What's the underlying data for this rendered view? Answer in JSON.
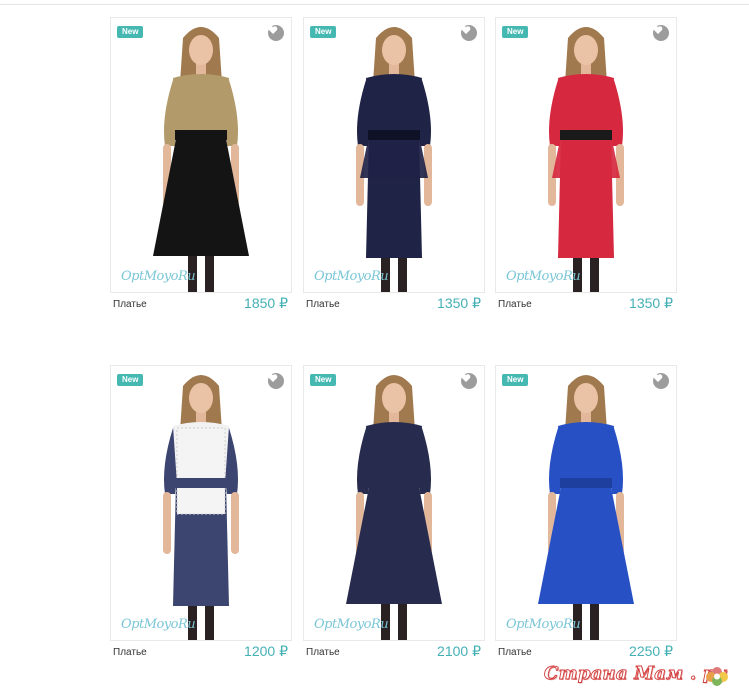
{
  "products": [
    {
      "badge": "New",
      "name": "Платье",
      "price": "1850 ₽",
      "watermark": "OptMoyoRu",
      "dress": {
        "top": "#b39a6b",
        "skirt": "#141414",
        "belt": "#141414",
        "sleeve": "#b39a6b",
        "style": "blouse"
      }
    },
    {
      "badge": "New",
      "name": "Платье",
      "price": "1350 ₽",
      "watermark": "OptMoyoRu",
      "dress": {
        "top": "#1f2346",
        "skirt": "#1f2346",
        "belt": "#0f1126",
        "sleeve": "#1f2346",
        "style": "peplum"
      }
    },
    {
      "badge": "New",
      "name": "Платье",
      "price": "1350 ₽",
      "watermark": "OptMoyoRu",
      "dress": {
        "top": "#d6283f",
        "skirt": "#d6283f",
        "belt": "#1a1a1a",
        "sleeve": "#d6283f",
        "style": "peplum"
      }
    },
    {
      "badge": "New",
      "name": "Платье",
      "price": "1200 ₽",
      "watermark": "OptMoyoRu",
      "dress": {
        "top": "#f2f2f2",
        "skirt": "#3c4470",
        "belt": "#3c4470",
        "sleeve": "#3c4470",
        "style": "lace"
      }
    },
    {
      "badge": "New",
      "name": "Платье",
      "price": "2100 ₽",
      "watermark": "OptMoyoRu",
      "dress": {
        "top": "#272c4e",
        "skirt": "#272c4e",
        "belt": "#272c4e",
        "sleeve": "#272c4e",
        "style": "flare"
      }
    },
    {
      "badge": "New",
      "name": "Платье",
      "price": "2250 ₽",
      "watermark": "OptMoyoRu",
      "dress": {
        "top": "#2650c4",
        "skirt": "#2650c4",
        "belt": "#1e3f9e",
        "sleeve": "#2650c4",
        "style": "flare"
      }
    }
  ],
  "footer": {
    "logo_text": "Страна Мам . ру"
  }
}
